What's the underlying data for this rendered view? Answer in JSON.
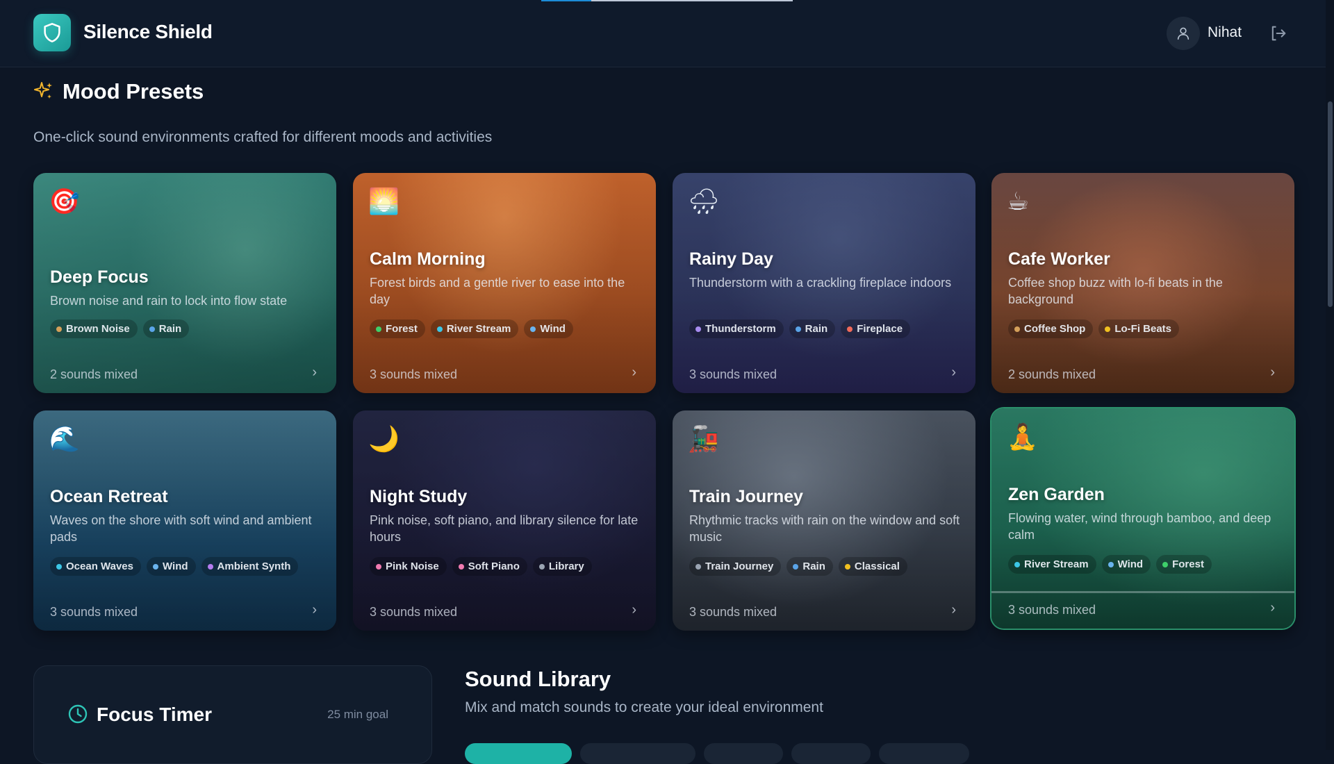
{
  "app": {
    "name": "Silence Shield",
    "loading_progress": 0.2
  },
  "user": {
    "name": "Nihat"
  },
  "icons": {
    "logo": "shield-icon",
    "user": "user-icon",
    "logout": "logout-icon",
    "section": "sparkles-icon",
    "timer": "clock-icon",
    "card_arrow": "chevron-right-icon"
  },
  "moods": {
    "title": "Mood Presets",
    "subtitle": "One-click sound environments crafted for different moods and activities",
    "cards": [
      {
        "emoji": "🎯",
        "name": "Deep Focus",
        "description": "Brown noise and rain to lock into flow state",
        "tags": [
          {
            "label": "Brown Noise",
            "color": "#d4a05a"
          },
          {
            "label": "Rain",
            "color": "#5aa4e8"
          }
        ],
        "footer": "2 sounds mixed",
        "chevron": "›"
      },
      {
        "emoji": "🌅",
        "name": "Calm Morning",
        "description": "Forest birds and a gentle river to ease into the day",
        "tags": [
          {
            "label": "Forest",
            "color": "#3ecf6a"
          },
          {
            "label": "River Stream",
            "color": "#3cc6e6"
          },
          {
            "label": "Wind",
            "color": "#6ab4ee"
          }
        ],
        "footer": "3 sounds mixed",
        "chevron": "›"
      },
      {
        "emoji": "🌧",
        "name": "Rainy Day",
        "description": "Thunderstorm with a crackling fireplace indoors",
        "tags": [
          {
            "label": "Thunderstorm",
            "color": "#a88cf0"
          },
          {
            "label": "Rain",
            "color": "#5aa4e8"
          },
          {
            "label": "Fireplace",
            "color": "#f06a5a"
          }
        ],
        "footer": "3 sounds mixed",
        "chevron": "›"
      },
      {
        "emoji": "☕",
        "name": "Cafe Worker",
        "description": "Coffee shop buzz with lo-fi beats in the background",
        "tags": [
          {
            "label": "Coffee Shop",
            "color": "#d4a05a"
          },
          {
            "label": "Lo-Fi Beats",
            "color": "#f0c020"
          }
        ],
        "footer": "2 sounds mixed",
        "chevron": "›"
      },
      {
        "emoji": "🌊",
        "name": "Ocean Retreat",
        "description": "Waves on the shore with soft wind and ambient pads",
        "tags": [
          {
            "label": "Ocean Waves",
            "color": "#3cc6e6"
          },
          {
            "label": "Wind",
            "color": "#6ab4ee"
          },
          {
            "label": "Ambient Synth",
            "color": "#b47cf0"
          }
        ],
        "footer": "3 sounds mixed",
        "chevron": "›"
      },
      {
        "emoji": "🌙",
        "name": "Night Study",
        "description": "Pink noise, soft piano, and library silence for late hours",
        "tags": [
          {
            "label": "Pink Noise",
            "color": "#f07ab0"
          },
          {
            "label": "Soft Piano",
            "color": "#f07ab0"
          },
          {
            "label": "Library",
            "color": "#9aa4b2"
          }
        ],
        "footer": "3 sounds mixed",
        "chevron": "›"
      },
      {
        "emoji": "🚂",
        "name": "Train Journey",
        "description": "Rhythmic tracks with rain on the window and soft music",
        "tags": [
          {
            "label": "Train Journey",
            "color": "#9aa4b2"
          },
          {
            "label": "Rain",
            "color": "#5aa4e8"
          },
          {
            "label": "Classical",
            "color": "#f0c020"
          }
        ],
        "footer": "3 sounds mixed",
        "chevron": "›"
      },
      {
        "emoji": "🧘",
        "name": "Zen Garden",
        "description": "Flowing water, wind through bamboo, and deep calm",
        "tags": [
          {
            "label": "River Stream",
            "color": "#3cc6e6"
          },
          {
            "label": "Wind",
            "color": "#6ab4ee"
          },
          {
            "label": "Forest",
            "color": "#3ecf6a"
          }
        ],
        "footer": "3 sounds mixed",
        "chevron": "›"
      }
    ]
  },
  "timer": {
    "title": "Focus Timer",
    "goal": "25 min goal"
  },
  "library": {
    "title": "Sound Library",
    "subtitle": "Mix and match sounds to create your ideal environment"
  }
}
